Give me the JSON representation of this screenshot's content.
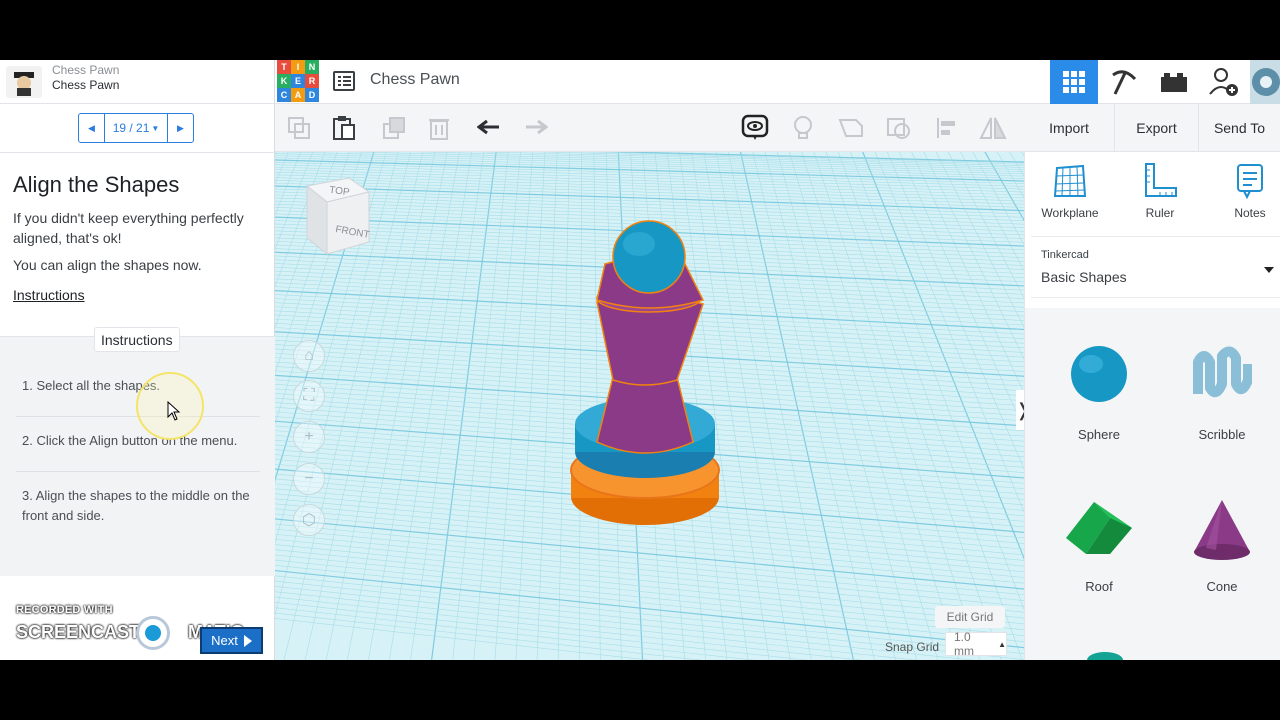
{
  "lesson": {
    "parent_title": "Chess Pawn",
    "title": "Chess Pawn",
    "pager": "19 / 21",
    "step_title": "Align the Shapes",
    "text1": "If you didn't keep everything perfectly aligned, that's ok!",
    "text2": "You can align the shapes now.",
    "link": "Instructions",
    "instructions_tab": "Instructions",
    "instructions": [
      "1. Select all the shapes.",
      "2. Click the Align button on the menu.",
      "3. Align the shapes to the middle on the front and side."
    ],
    "next_label": "Next"
  },
  "watermark": {
    "recorded": "RECORDED WITH",
    "name": "SCREENCAST",
    "name2": "MATIC"
  },
  "logo": {
    "letters": [
      "T",
      "I",
      "N",
      "K",
      "E",
      "R",
      "C",
      "A",
      "D"
    ]
  },
  "header": {
    "design_title": "Chess Pawn"
  },
  "actions": {
    "import": "Import",
    "export": "Export",
    "send_to": "Send To"
  },
  "panel": {
    "tools": [
      "Workplane",
      "Ruler",
      "Notes"
    ],
    "library_small": "Tinkercad",
    "library_name": "Basic Shapes",
    "shapes": [
      "Sphere",
      "Scribble",
      "Roof",
      "Cone"
    ]
  },
  "viewcube": {
    "top": "TOP",
    "front": "FRONT"
  },
  "grid": {
    "edit": "Edit Grid",
    "snap_label": "Snap Grid",
    "snap_value": "1.0 mm"
  },
  "colors": {
    "accent": "#2a8ce8",
    "pawn_purple": "#8b3a87",
    "pawn_blue": "#1798c4",
    "pawn_orange": "#f2820f"
  }
}
